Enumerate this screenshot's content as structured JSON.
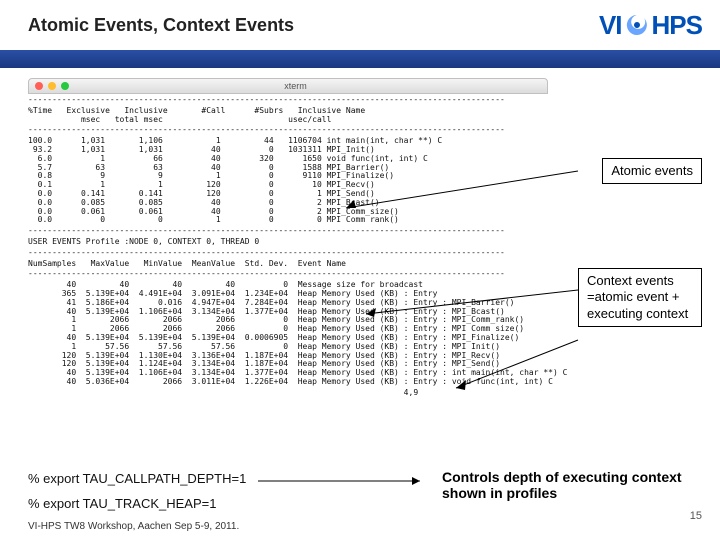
{
  "header": {
    "title": "Atomic Events, Context Events",
    "logo_vi": "VI",
    "logo_hps": "HPS"
  },
  "terminal": {
    "title": "xterm",
    "head_cols": "%Time   Exclusive   Inclusive       #Call      #Subrs   Inclusive Name\n           msec   total msec                          usec/call",
    "dash": "---------------------------------------------------------------------------------------------------",
    "rows": [
      "100.0      1,031       1,106           1         44   1106704 int main(int, char **) C",
      " 93.2      1,031       1,031          40          0   1031311 MPI_Init()",
      "  6.0          1          66          40        320      1650 void func(int, int) C",
      "  5.7         63          63          40          0      1588 MPI_Barrier()",
      "  0.8          9           9           1          0      9110 MPI_Finalize()",
      "  0.1          1           1         120          0        10 MPI_Recv()",
      "  0.0      0.141       0.141         120          0         1 MPI_Send()",
      "  0.0      0.085       0.085          40          0         2 MPI_Bcast()",
      "  0.0      0.061       0.061          40          0         2 MPI_Comm_size()",
      "  0.0          0           0           1          0         0 MPI Comm rank()"
    ],
    "user_events_title": "USER EVENTS Profile :NODE 0, CONTEXT 0, THREAD 0",
    "ue_head": "NumSamples   MaxValue   MinValue  MeanValue  Std. Dev.  Event Name",
    "ue_rows": [
      "        40         40         40         40          0  Message size for broadcast",
      "       365  5.139E+04  4.491E+04  3.091E+04  1.234E+04  Heap Memory Used (KB) : Entry",
      "        41  5.186E+04      0.016  4.947E+04  7.284E+04  Heap Memory Used (KB) : Entry : MPI_Barrier()",
      "        40  5.139E+04  1.106E+04  3.134E+04  1.377E+04  Heap Memory Used (KB) : Entry : MPI_Bcast()",
      "         1       2066       2066       2066          0  Heap Memory Used (KB) : Entry : MPI_Comm_rank()",
      "         1       2066       2066       2066          0  Heap Memory Used (KB) : Entry : MPI Comm size()",
      "        40  5.139E+04  5.139E+04  5.139E+04  0.0006905  Heap Memory Used (KB) : Entry : MPI_Finalize()",
      "         1      57.56      57.56      57.56          0  Heap Memory Used (KB) : Entry : MPI Init()",
      "       120  5.139E+04  1.130E+04  3.136E+04  1.187E+04  Heap Memory Used (KB) : Entry : MPI_Recv()",
      "       120  5.139E+04  1.124E+04  3.134E+04  1.187E+04  Heap Memory Used (KB) : Entry : MPI_Send()",
      "        40  5.139E+04  1.106E+04  3.134E+04  1.377E+04  Heap Memory Used (KB) : Entry : int main(int, char **) C",
      "        40  5.036E+04       2066  3.011E+04  1.226E+04  Heap Memory Used (KB) : Entry : void func(int, int) C"
    ],
    "tail": "                                                                              4,9"
  },
  "callouts": {
    "atomic": "Atomic events",
    "context": "Context events =atomic event + executing context"
  },
  "commands": {
    "callpath": "% export TAU_CALLPATH_DEPTH=1",
    "heap": "% export TAU_TRACK_HEAP=1"
  },
  "controls_note": "Controls depth of executing context shown in profiles",
  "footer": {
    "event": "VI-HPS TW8 Workshop, Aachen Sep 5-9, 2011.",
    "page": "15"
  }
}
